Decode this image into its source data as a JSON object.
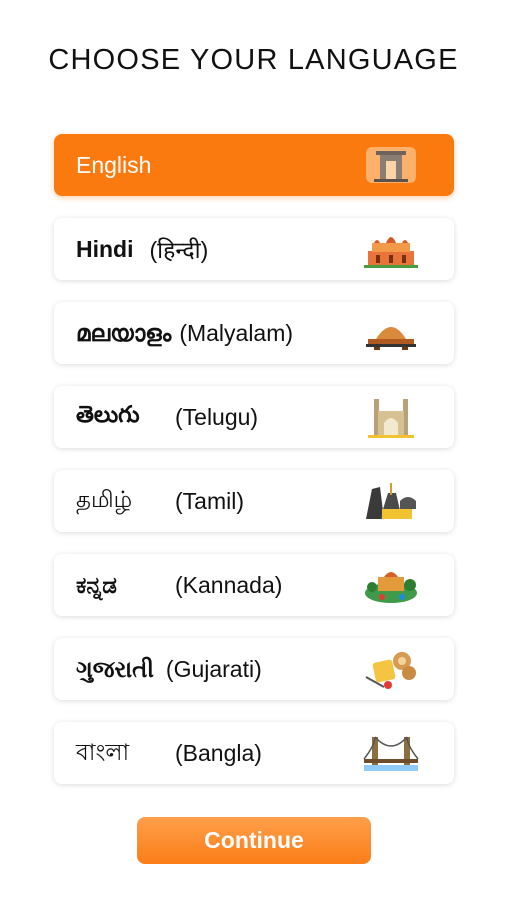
{
  "header": {
    "title": "CHOOSE YOUR LANGUAGE"
  },
  "languages": [
    {
      "native": "",
      "english": "English",
      "icon": "india-gate-icon",
      "selected": true
    },
    {
      "native": "Hindi",
      "english": "(हिन्दी)",
      "icon": "palace-icon",
      "selected": false
    },
    {
      "native": "മലയാളം",
      "english": "(Malyalam)",
      "icon": "dome-landmark-icon",
      "selected": false
    },
    {
      "native": "తెలుగు",
      "english": "(Telugu)",
      "icon": "charminar-icon",
      "selected": false
    },
    {
      "native": "தமிழ்",
      "english": "(Tamil)",
      "icon": "temple-icon",
      "selected": false
    },
    {
      "native": "ಕನ್ನಡ",
      "english": "(Kannada)",
      "icon": "palace-garden-icon",
      "selected": false
    },
    {
      "native": "ગુજરાતી",
      "english": "(Gujarati)",
      "icon": "snacks-icon",
      "selected": false
    },
    {
      "native": "বাংলা",
      "english": "(Bangla)",
      "icon": "bridge-icon",
      "selected": false
    }
  ],
  "footer": {
    "continue_label": "Continue"
  },
  "colors": {
    "accent": "#fb7a10",
    "text": "#111111",
    "background": "#ffffff"
  }
}
